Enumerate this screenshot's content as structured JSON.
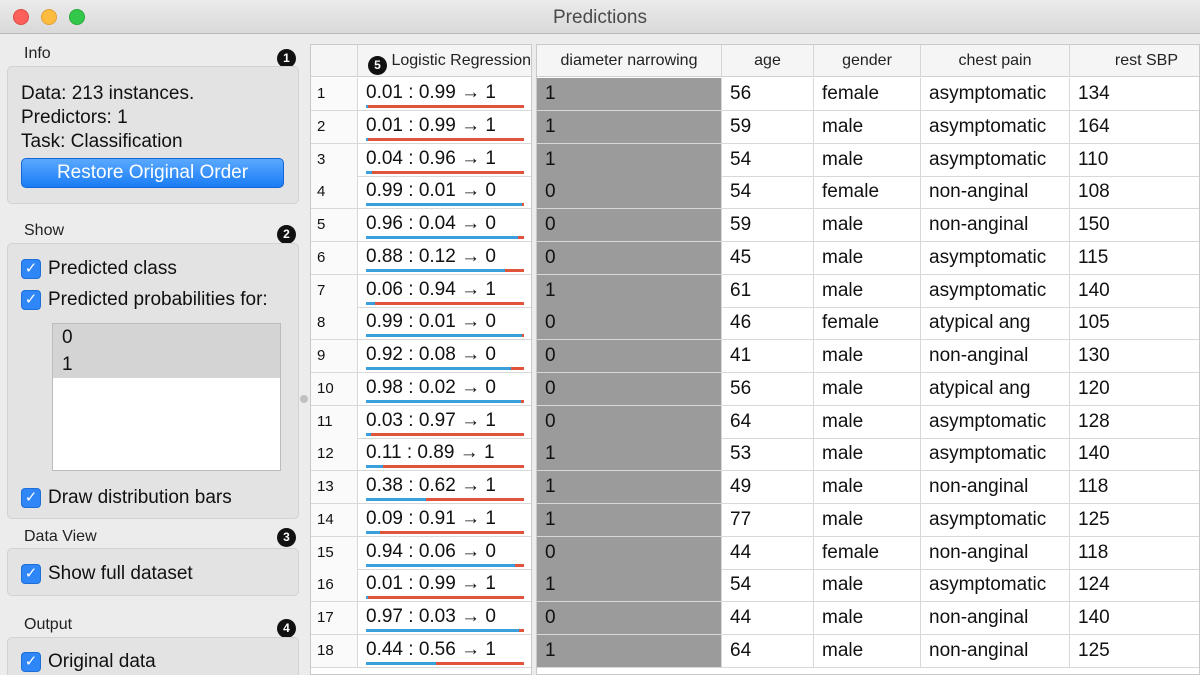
{
  "window": {
    "title": "Predictions"
  },
  "info": {
    "title": "Info",
    "badge": "1",
    "data_line": "Data: 213 instances.",
    "predictors_line": "Predictors: 1",
    "task_line": "Task: Classification",
    "restore_button": "Restore Original Order"
  },
  "show": {
    "title": "Show",
    "badge": "2",
    "predicted_class": "Predicted class",
    "predicted_probs": "Predicted probabilities for:",
    "classes": [
      "0",
      "1"
    ],
    "draw_bars": "Draw distribution bars"
  },
  "data_view": {
    "title": "Data View",
    "badge": "3",
    "show_full": "Show full dataset"
  },
  "output": {
    "title": "Output",
    "badge": "4",
    "original_data": "Original data"
  },
  "predictions_table": {
    "badge": "5",
    "header": "Logistic Regression"
  },
  "data_table": {
    "columns": [
      "diameter narrowing",
      "age",
      "gender",
      "chest pain",
      "rest SBP"
    ]
  },
  "rows": [
    {
      "n": "1",
      "pred": "0.01 : 0.99 → 1",
      "p0": 0.01,
      "dn": "1",
      "age": "56",
      "gender": "female",
      "cp": "asymptomatic",
      "sbp": "134"
    },
    {
      "n": "2",
      "pred": "0.01 : 0.99 → 1",
      "p0": 0.01,
      "dn": "1",
      "age": "59",
      "gender": "male",
      "cp": "asymptomatic",
      "sbp": "164"
    },
    {
      "n": "3",
      "pred": "0.04 : 0.96 → 1",
      "p0": 0.04,
      "dn": "1",
      "age": "54",
      "gender": "male",
      "cp": "asymptomatic",
      "sbp": "110"
    },
    {
      "n": "4",
      "pred": "0.99 : 0.01 → 0",
      "p0": 0.99,
      "dn": "0",
      "age": "54",
      "gender": "female",
      "cp": "non-anginal",
      "sbp": "108"
    },
    {
      "n": "5",
      "pred": "0.96 : 0.04 → 0",
      "p0": 0.96,
      "dn": "0",
      "age": "59",
      "gender": "male",
      "cp": "non-anginal",
      "sbp": "150"
    },
    {
      "n": "6",
      "pred": "0.88 : 0.12 → 0",
      "p0": 0.88,
      "dn": "0",
      "age": "45",
      "gender": "male",
      "cp": "asymptomatic",
      "sbp": "115"
    },
    {
      "n": "7",
      "pred": "0.06 : 0.94 → 1",
      "p0": 0.06,
      "dn": "1",
      "age": "61",
      "gender": "male",
      "cp": "asymptomatic",
      "sbp": "140"
    },
    {
      "n": "8",
      "pred": "0.99 : 0.01 → 0",
      "p0": 0.99,
      "dn": "0",
      "age": "46",
      "gender": "female",
      "cp": "atypical ang",
      "sbp": "105"
    },
    {
      "n": "9",
      "pred": "0.92 : 0.08 → 0",
      "p0": 0.92,
      "dn": "0",
      "age": "41",
      "gender": "male",
      "cp": "non-anginal",
      "sbp": "130"
    },
    {
      "n": "10",
      "pred": "0.98 : 0.02 → 0",
      "p0": 0.98,
      "dn": "0",
      "age": "56",
      "gender": "male",
      "cp": "atypical ang",
      "sbp": "120"
    },
    {
      "n": "11",
      "pred": "0.03 : 0.97 → 1",
      "p0": 0.03,
      "dn": "0",
      "age": "64",
      "gender": "male",
      "cp": "asymptomatic",
      "sbp": "128"
    },
    {
      "n": "12",
      "pred": "0.11 : 0.89 → 1",
      "p0": 0.11,
      "dn": "1",
      "age": "53",
      "gender": "male",
      "cp": "asymptomatic",
      "sbp": "140"
    },
    {
      "n": "13",
      "pred": "0.38 : 0.62 → 1",
      "p0": 0.38,
      "dn": "1",
      "age": "49",
      "gender": "male",
      "cp": "non-anginal",
      "sbp": "118"
    },
    {
      "n": "14",
      "pred": "0.09 : 0.91 → 1",
      "p0": 0.09,
      "dn": "1",
      "age": "77",
      "gender": "male",
      "cp": "asymptomatic",
      "sbp": "125"
    },
    {
      "n": "15",
      "pred": "0.94 : 0.06 → 0",
      "p0": 0.94,
      "dn": "0",
      "age": "44",
      "gender": "female",
      "cp": "non-anginal",
      "sbp": "118"
    },
    {
      "n": "16",
      "pred": "0.01 : 0.99 → 1",
      "p0": 0.01,
      "dn": "1",
      "age": "54",
      "gender": "male",
      "cp": "asymptomatic",
      "sbp": "124"
    },
    {
      "n": "17",
      "pred": "0.97 : 0.03 → 0",
      "p0": 0.97,
      "dn": "0",
      "age": "44",
      "gender": "male",
      "cp": "non-anginal",
      "sbp": "140"
    },
    {
      "n": "18",
      "pred": "0.44 : 0.56 → 1",
      "p0": 0.44,
      "dn": "1",
      "age": "64",
      "gender": "male",
      "cp": "non-anginal",
      "sbp": "125"
    }
  ]
}
